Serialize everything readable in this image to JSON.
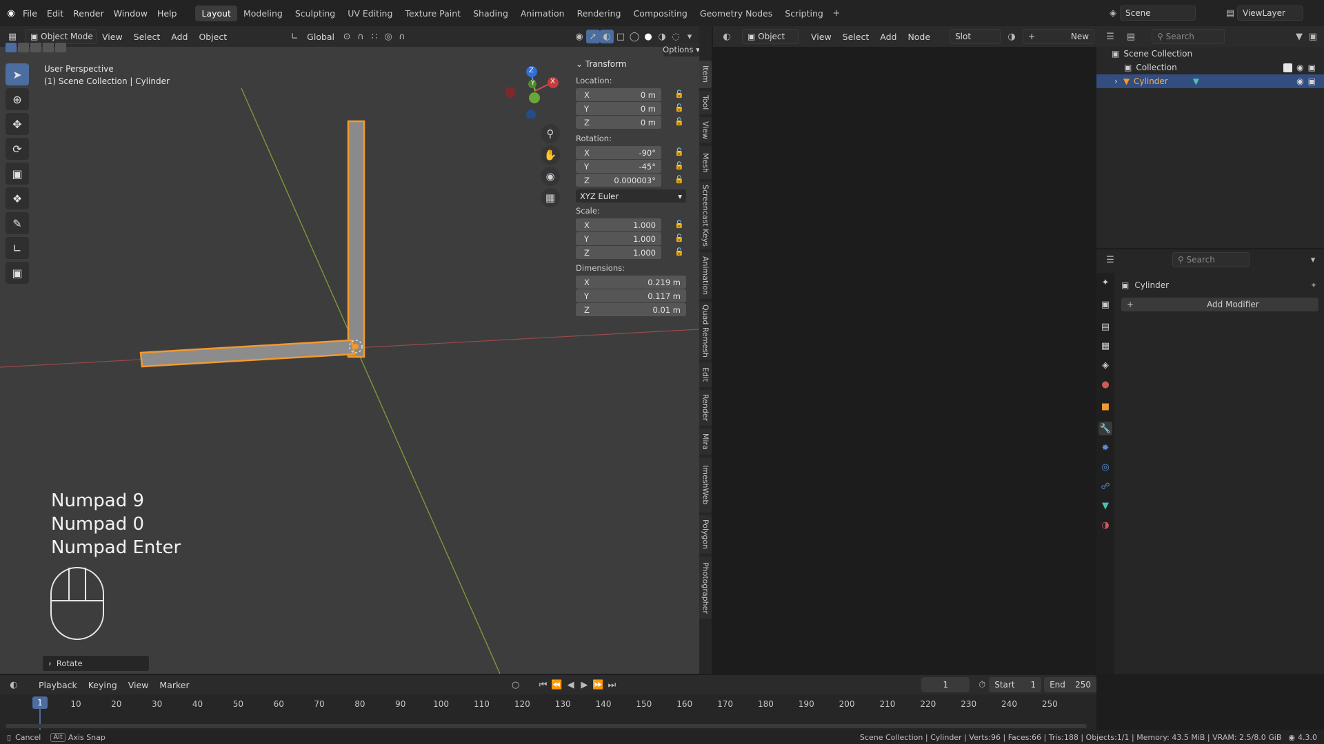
{
  "topbar": {
    "menus": [
      "File",
      "Edit",
      "Render",
      "Window",
      "Help"
    ],
    "workspaces": [
      "Layout",
      "Modeling",
      "Sculpting",
      "UV Editing",
      "Texture Paint",
      "Shading",
      "Animation",
      "Rendering",
      "Compositing",
      "Geometry Nodes",
      "Scripting"
    ],
    "active_workspace": "Layout",
    "scene": "Scene",
    "view_layer": "ViewLayer"
  },
  "viewport": {
    "mode": "Object Mode",
    "menus": [
      "View",
      "Select",
      "Add",
      "Object"
    ],
    "orientation": "Global",
    "options": "Options",
    "perspective": "User Perspective",
    "context": "(1) Scene Collection | Cylinder",
    "operator_panel": "Rotate",
    "gizmo": {
      "x": "X",
      "y": "Y",
      "z": "Z"
    },
    "keys": [
      "Numpad 9",
      "Numpad 0",
      "Numpad Enter"
    ]
  },
  "transform": {
    "header": "Transform",
    "location_label": "Location:",
    "location": [
      {
        "axis": "X",
        "value": "0 m"
      },
      {
        "axis": "Y",
        "value": "0 m"
      },
      {
        "axis": "Z",
        "value": "0 m"
      }
    ],
    "rotation_label": "Rotation:",
    "rotation": [
      {
        "axis": "X",
        "value": "-90°"
      },
      {
        "axis": "Y",
        "value": "-45°"
      },
      {
        "axis": "Z",
        "value": "0.000003°"
      }
    ],
    "rotation_mode": "XYZ Euler",
    "scale_label": "Scale:",
    "scale": [
      {
        "axis": "X",
        "value": "1.000"
      },
      {
        "axis": "Y",
        "value": "1.000"
      },
      {
        "axis": "Z",
        "value": "1.000"
      }
    ],
    "dimensions_label": "Dimensions:",
    "dimensions": [
      {
        "axis": "X",
        "value": "0.219 m"
      },
      {
        "axis": "Y",
        "value": "0.117 m"
      },
      {
        "axis": "Z",
        "value": "0.01 m"
      }
    ]
  },
  "side_tabs": [
    "Item",
    "Tool",
    "View",
    "Mesh",
    "Screencast Keys",
    "Animation",
    "Quad Remesh",
    "Edit",
    "Render",
    "Mira",
    "ImeshWeb",
    "Polygon",
    "Photographer"
  ],
  "shader": {
    "object": "Object",
    "menus": [
      "View",
      "Select",
      "Add",
      "Node"
    ],
    "slot": "Slot",
    "new": "New"
  },
  "outliner": {
    "search": "Search",
    "scene_collection": "Scene Collection",
    "collection": "Collection",
    "object": "Cylinder"
  },
  "properties": {
    "search": "Search",
    "object": "Cylinder",
    "add_modifier": "Add Modifier"
  },
  "timeline": {
    "menus": [
      "Playback",
      "Keying",
      "View",
      "Marker"
    ],
    "current_frame": "1",
    "start_label": "Start",
    "start": "1",
    "end_label": "End",
    "end": "250",
    "ticks": [
      "1",
      "10",
      "20",
      "30",
      "40",
      "50",
      "60",
      "70",
      "80",
      "90",
      "100",
      "110",
      "120",
      "130",
      "140",
      "150",
      "160",
      "170",
      "180",
      "190",
      "200",
      "210",
      "220",
      "230",
      "240",
      "250"
    ]
  },
  "statusbar": {
    "cancel": "Cancel",
    "alt": "Alt",
    "axis_snap": "Axis Snap",
    "info": "Scene Collection | Cylinder | Verts:96 | Faces:66 | Tris:188 | Objects:1/1 | Memory: 43.5 MiB | VRAM: 2.5/8.0 GiB",
    "version": "4.3.0"
  }
}
